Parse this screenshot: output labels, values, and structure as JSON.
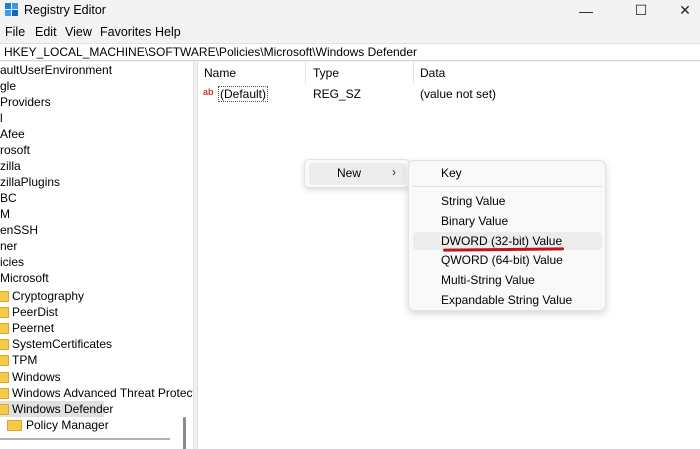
{
  "window": {
    "title": "Registry Editor",
    "minimize_glyph": "—",
    "maximize_glyph": "☐",
    "close_glyph": "✕"
  },
  "menubar": [
    "File",
    "Edit",
    "View",
    "Favorites",
    "Help"
  ],
  "address": "HKEY_LOCAL_MACHINE\\SOFTWARE\\Policies\\Microsoft\\Windows Defender",
  "tree": [
    {
      "label": "aultUserEnvironment"
    },
    {
      "label": "gle"
    },
    {
      "label": "Providers"
    },
    {
      "label": "l"
    },
    {
      "label": "Afee"
    },
    {
      "label": "rosoft"
    },
    {
      "label": "zilla"
    },
    {
      "label": "zillaPlugins"
    },
    {
      "label": "BC"
    },
    {
      "label": "M"
    },
    {
      "label": "enSSH"
    },
    {
      "label": "ner"
    },
    {
      "label": "icies"
    },
    {
      "label": "Microsoft"
    },
    {
      "label": "Cryptography"
    },
    {
      "label": "PeerDist"
    },
    {
      "label": "Peernet"
    },
    {
      "label": "SystemCertificates"
    },
    {
      "label": "TPM"
    },
    {
      "label": "Windows"
    },
    {
      "label": "Windows Advanced Threat Protect"
    },
    {
      "label": "Windows Defender"
    },
    {
      "label": "Policy Manager"
    }
  ],
  "list": {
    "columns": [
      "Name",
      "Type",
      "Data"
    ],
    "rows": [
      {
        "icon": "ab",
        "name": "(Default)",
        "type": "REG_SZ",
        "data": "(value not set)"
      }
    ]
  },
  "context_menu": {
    "new_label": "New",
    "arrow": "›"
  },
  "submenu": {
    "items": [
      "Key",
      "String Value",
      "Binary Value",
      "DWORD (32-bit) Value",
      "QWORD (64-bit) Value",
      "Multi-String Value",
      "Expandable String Value"
    ],
    "highlighted": "DWORD (32-bit) Value"
  },
  "colors": {
    "folder": "#f6c94a",
    "underline": "#c4141b",
    "selection": "#e0e0e0"
  }
}
